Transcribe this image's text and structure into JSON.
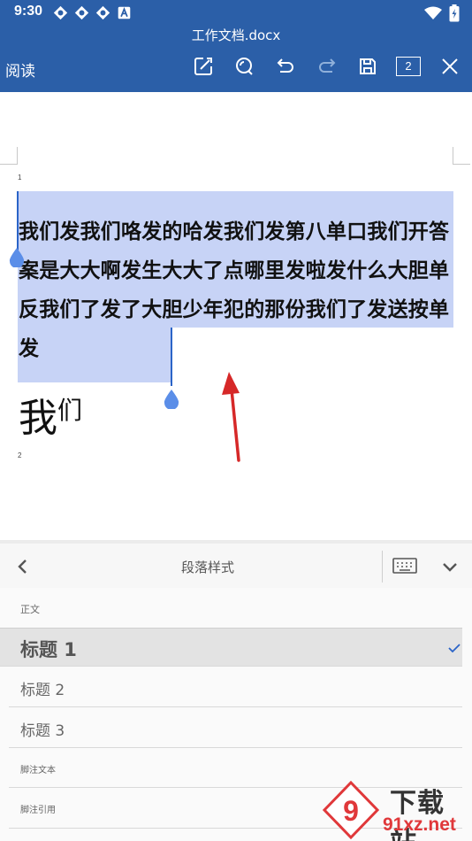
{
  "status_bar": {
    "time": "9:30",
    "icons": [
      "app-notification-icon",
      "app-notification-icon",
      "app-notification-icon",
      "a-notification-icon"
    ],
    "right_icons": [
      "wifi-icon",
      "battery-icon"
    ]
  },
  "header": {
    "doc_title": "工作文档.docx",
    "mode_label": "阅读",
    "toolbar": {
      "edit_icon": "edit-icon",
      "search_icon": "search-icon",
      "undo_icon": "undo-icon",
      "redo_icon": "redo-icon",
      "save_icon": "save-icon",
      "page_count": "2",
      "close_icon": "close-icon"
    },
    "bg_color": "#2b5fa8"
  },
  "document": {
    "page_numbers": [
      "1",
      "2"
    ],
    "paragraph_1": "我们发我们咯发的哈发我们发第八单口我们开答案是大大啊发生大大了点哪里发啦发什么大胆单反我们了发了大胆少年犯的那份我们了发送按单发",
    "paragraph_2_big": "我",
    "paragraph_2_small": "们",
    "selection_color": "#c7d3f6"
  },
  "panel": {
    "title": "段落样式",
    "styles": [
      {
        "label": "正文",
        "selected": false
      },
      {
        "label": "标题 1",
        "selected": true
      },
      {
        "label": "标题 2",
        "selected": false
      },
      {
        "label": "标题 3",
        "selected": false
      },
      {
        "label": "脚注文本",
        "selected": false
      },
      {
        "label": "脚注引用",
        "selected": false
      }
    ]
  },
  "watermark": {
    "line1": "下载站",
    "line2": "91xz.net",
    "accent": "#e0383a"
  }
}
